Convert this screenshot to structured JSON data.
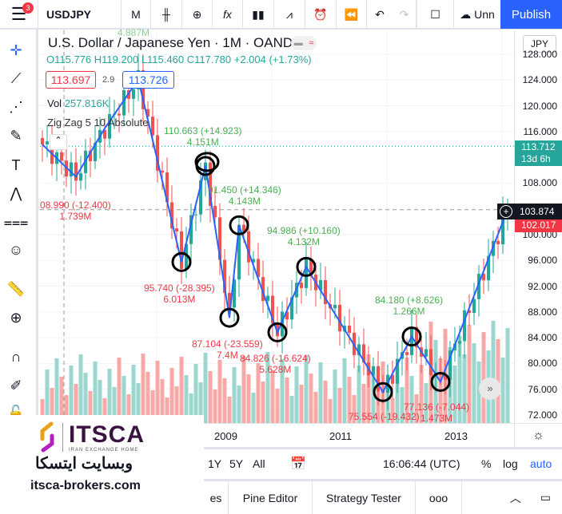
{
  "toolbar": {
    "menu_badge": "3",
    "symbol": "USDJPY",
    "interval": "M",
    "layout_name": "Unn",
    "publish": "Publish"
  },
  "legend": {
    "title": "U.S. Dollar / Japanese Yen · 1M · OANDA",
    "o": "O115.776",
    "h": "H119.200",
    "l": "L115.460",
    "c": "C117.780",
    "change": "+2.004 (+1.73%)",
    "sell": "113.697",
    "spread": "2.9",
    "buy": "113.726",
    "vol_label": "Vol",
    "vol_value": "257.816K",
    "indicator": "Zig Zag 5 10 Absolute"
  },
  "price_axis": {
    "currency": "JPY",
    "ticks": [
      "128.000",
      "124.000",
      "120.000",
      "116.000",
      "108.000",
      "100.000",
      "96.000",
      "92.000",
      "88.000",
      "84.000",
      "80.000",
      "76.000",
      "72.000"
    ],
    "last_price": "113.712",
    "countdown": "13d 6h",
    "crosshair_price": "103.874",
    "red_label": "102.017"
  },
  "time_axis": {
    "ticks": [
      "2009",
      "2011",
      "2013"
    ]
  },
  "bottom_bar": {
    "ranges": [
      "1Y",
      "5Y",
      "All"
    ],
    "time": "16:06:44 (UTC)",
    "percent": "%",
    "log": "log",
    "auto": "auto"
  },
  "tabs": {
    "partial": "es",
    "pine": "Pine Editor",
    "strategy": "Strategy Tester",
    "more": "ooo"
  },
  "watermark": {
    "brand": "ITSCA",
    "tagline": "IRAN EXCHANGE HOME",
    "persian": "وبسایت ایتسکا",
    "url": "itsca-brokers.com"
  },
  "annotations": [
    {
      "text": "08.990 (-12.400)",
      "sub": "1.739M",
      "color": "red"
    },
    {
      "text": "110.663 (+14.923)",
      "sub": "4.151M",
      "color": "green"
    },
    {
      "text": "01.450 (+14.346)",
      "sub": "4.143M",
      "color": "green"
    },
    {
      "text": "95.740 (-28.395)",
      "sub": "6.013M",
      "color": "red"
    },
    {
      "text": "94.986 (+10.160)",
      "sub": "4.132M",
      "color": "green"
    },
    {
      "text": "87.104 (-23.559)",
      "sub": "7.4M",
      "color": "red"
    },
    {
      "text": "84.826 (-16.624)",
      "sub": "5.628M",
      "color": "red"
    },
    {
      "text": "84.180 (+8.626)",
      "sub": "1.266M",
      "color": "green"
    },
    {
      "text": "77.136 (-7.044)",
      "sub": "1.473M",
      "color": "red"
    },
    {
      "text": "75.554 (-19.432)",
      "sub": "",
      "color": "red"
    },
    {
      "text": "4.887M",
      "sub": "",
      "color": "green"
    }
  ],
  "chart_data": {
    "type": "candlestick",
    "ylim": [
      72,
      132
    ],
    "y_ticks": [
      72,
      76,
      80,
      84,
      88,
      92,
      96,
      100,
      108,
      116,
      120,
      124,
      128
    ],
    "x_ticks": [
      "2009",
      "2011",
      "2013"
    ],
    "colors": {
      "up": "#26a69a",
      "down": "#ef5350",
      "zigzag": "#2962ff"
    },
    "zigzag_pivots": [
      {
        "date": "2005-10",
        "price": 114.0
      },
      {
        "date": "2006-05",
        "price": 108.99
      },
      {
        "date": "2006-11",
        "price": 116.5
      },
      {
        "date": "2007-06",
        "price": 124.1
      },
      {
        "date": "2008-03",
        "price": 95.74
      },
      {
        "date": "2008-08",
        "price": 110.66
      },
      {
        "date": "2009-01",
        "price": 87.1
      },
      {
        "date": "2009-03",
        "price": 101.45
      },
      {
        "date": "2009-11",
        "price": 84.83
      },
      {
        "date": "2010-05",
        "price": 94.99
      },
      {
        "date": "2011-09",
        "price": 75.55
      },
      {
        "date": "2012-03",
        "price": 84.18
      },
      {
        "date": "2012-09",
        "price": 77.14
      },
      {
        "date": "2013-11",
        "price": 103.9
      }
    ]
  }
}
